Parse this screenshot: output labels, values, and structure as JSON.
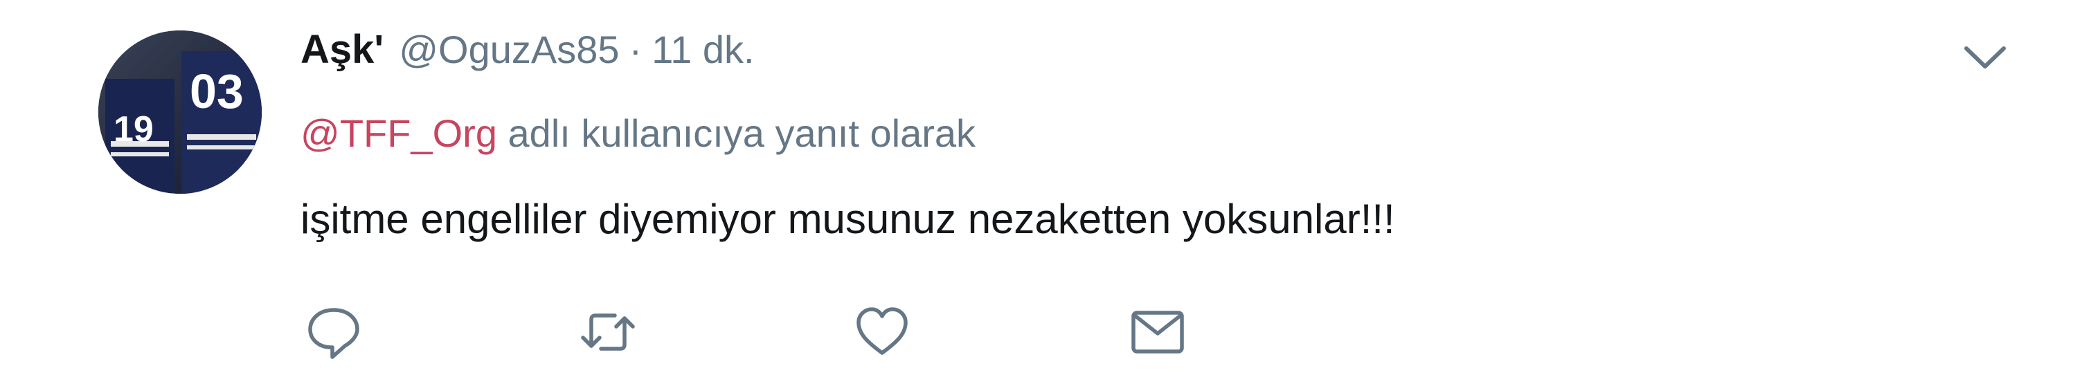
{
  "tweet": {
    "author": {
      "display_name": "Aşk'",
      "handle": "@OguzAs85",
      "avatar_jersey_numbers": [
        "19",
        "03"
      ]
    },
    "separator": "·",
    "timestamp": "11 dk.",
    "reply_context": {
      "mention": "@TFF_Org",
      "suffix": " adlı kullanıcıya yanıt olarak"
    },
    "text": "işitme engelliler diyemiyor musunuz nezaketten yoksunlar!!!"
  },
  "colors": {
    "text": "#14171a",
    "secondary": "#657786",
    "mention": "#c8445f",
    "icon": "#657786"
  },
  "icons": {
    "caret": "chevron-down-icon",
    "reply": "reply-icon",
    "retweet": "retweet-icon",
    "like": "heart-icon",
    "message": "envelope-icon"
  }
}
